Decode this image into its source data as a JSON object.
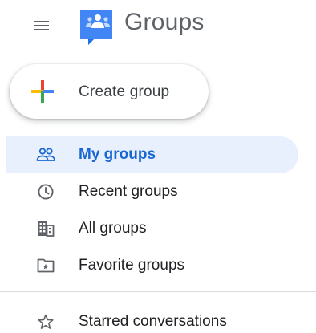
{
  "header": {
    "title": "Groups",
    "menu_icon": "hamburger-menu-icon",
    "logo_icon": "groups-logo-icon"
  },
  "create_button": {
    "label": "Create group",
    "icon": "multicolor-plus-icon"
  },
  "nav": {
    "items": [
      {
        "label": "My groups",
        "icon": "people-icon",
        "active": true
      },
      {
        "label": "Recent groups",
        "icon": "clock-icon",
        "active": false
      },
      {
        "label": "All groups",
        "icon": "building-icon",
        "active": false
      },
      {
        "label": "Favorite groups",
        "icon": "folder-star-icon",
        "active": false
      }
    ],
    "secondary_items": [
      {
        "label": "Starred conversations",
        "icon": "star-outline-icon",
        "active": false
      }
    ]
  },
  "colors": {
    "active_text": "#1967d2",
    "active_background": "#e8f0fe",
    "text": "#202124",
    "icon_gray": "#5f6368",
    "logo_blue": "#4285f4",
    "plus_red": "#ea4335",
    "plus_yellow": "#fbbc04",
    "plus_green": "#34a853",
    "plus_blue": "#4285f4"
  }
}
